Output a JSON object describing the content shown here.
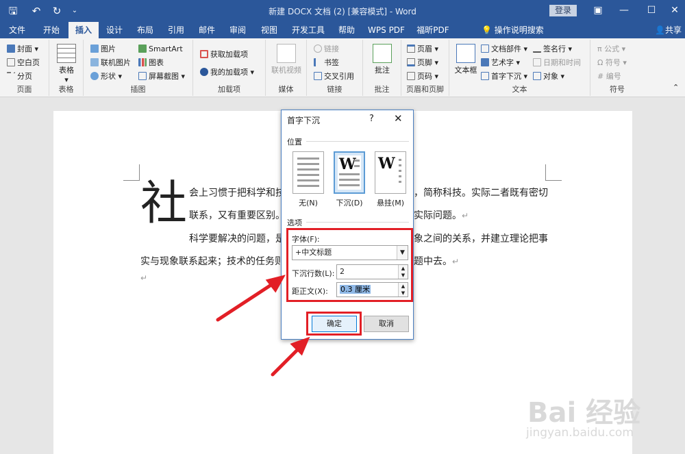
{
  "titlebar": {
    "title": "新建 DOCX 文档 (2) [兼容模式] - Word",
    "login": "登录"
  },
  "tabs": [
    "文件",
    "开始",
    "插入",
    "设计",
    "布局",
    "引用",
    "邮件",
    "审阅",
    "视图",
    "开发工具",
    "帮助",
    "WPS PDF",
    "福昕PDF"
  ],
  "tell_me": "操作说明搜索",
  "share": "共享",
  "ribbon": {
    "pages": {
      "items": [
        "封面",
        "空白页",
        "分页"
      ],
      "label": "页面"
    },
    "tables": {
      "item": "表格",
      "label": "表格"
    },
    "illustrations": {
      "items": [
        "图片",
        "联机图片",
        "形状",
        "SmartArt",
        "图表",
        "屏幕截图"
      ],
      "label": "插图"
    },
    "addins": {
      "items": [
        "获取加载项",
        "我的加载项"
      ],
      "label": "加载项"
    },
    "media": {
      "item": "联机视频",
      "label": "媒体"
    },
    "links": {
      "items": [
        "链接",
        "书签",
        "交叉引用"
      ],
      "label": "链接"
    },
    "comments": {
      "item": "批注",
      "label": "批注"
    },
    "headerfooter": {
      "items": [
        "页眉",
        "页脚",
        "页码"
      ],
      "label": "页眉和页脚"
    },
    "text": {
      "items": [
        "文本框",
        "文档部件",
        "艺术字",
        "首字下沉",
        "签名行",
        "日期和时间",
        "对象"
      ],
      "label": "文本"
    },
    "symbols": {
      "items": [
        "公式",
        "符号",
        "编号"
      ],
      "label": "符号"
    }
  },
  "document": {
    "dropcap": "社",
    "lines": [
      "会上习惯于把科学和技",
      "，简称科技。实际二者既有密切",
      "联系，又有重要区别。",
      "实际问题。",
      "科学要解决的问题，是",
      "象之间的关系，并建立理论把事",
      "实与现象联系起来；技术的任务则",
      "题中去。"
    ],
    "para_mark": "↵"
  },
  "dialog": {
    "title": "首字下沉",
    "help": "?",
    "close": "✕",
    "position_label": "位置",
    "positions": [
      {
        "label": "无(N)",
        "selected": false
      },
      {
        "label": "下沉(D)",
        "selected": true
      },
      {
        "label": "悬挂(M)",
        "selected": false
      }
    ],
    "options_label": "选项",
    "font_label": "字体(F):",
    "font_value": "+中文标题",
    "lines_label": "下沉行数(L):",
    "lines_value": "2",
    "distance_label": "距正文(X):",
    "distance_value": "0.3 厘米",
    "ok": "确定",
    "cancel": "取消"
  },
  "watermark": {
    "brand": "Bai 经验",
    "url": "jingyan.baidu.com"
  },
  "colors": {
    "accent": "#2b579a",
    "highlight": "#e21f26"
  }
}
